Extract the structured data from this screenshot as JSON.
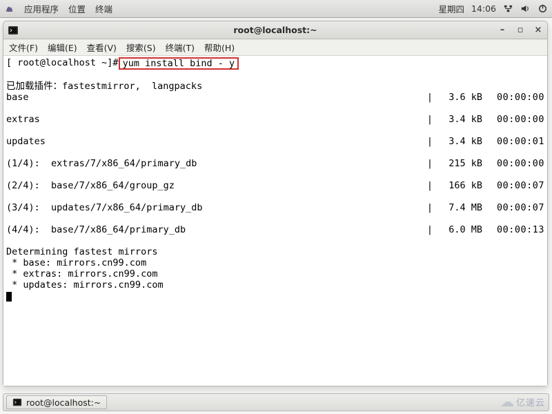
{
  "top_panel": {
    "menus": {
      "apps": "应用程序",
      "places": "位置",
      "terminal": "终端"
    },
    "clock_day": "星期四",
    "clock_time": "14:06"
  },
  "window": {
    "title": "root@localhost:~",
    "menus": {
      "file": "文件(F)",
      "edit": "编辑(E)",
      "view": "查看(V)",
      "search": "搜索(S)",
      "terminal": "终端(T)",
      "help": "帮助(H)"
    }
  },
  "terminal": {
    "prompt": "[ root@localhost ~]#",
    "command": "yum install bind - y",
    "line_plugins": "已加载插件：fastestmirror,  langpacks",
    "repos": [
      {
        "name": "base",
        "size": "3.6 kB",
        "time": "00:00:00"
      },
      {
        "name": "extras",
        "size": "3.4 kB",
        "time": "00:00:00"
      },
      {
        "name": "updates",
        "size": "3.4 kB",
        "time": "00:00:01"
      }
    ],
    "downloads": [
      {
        "name": "(1/4):  extras/7/x86_64/primary_db",
        "size": "215 kB",
        "time": "00:00:00"
      },
      {
        "name": "(2/4):  base/7/x86_64/group_gz",
        "size": "166 kB",
        "time": "00:00:07"
      },
      {
        "name": "(3/4):  updates/7/x86_64/primary_db",
        "size": "7.4 MB",
        "time": "00:00:07"
      },
      {
        "name": "(4/4):  base/7/x86_64/primary_db",
        "size": "6.0 MB",
        "time": "00:00:13"
      }
    ],
    "mirrors_header": "Determining fastest mirrors",
    "mirrors": [
      " * base: mirrors.cn99.com",
      " * extras: mirrors.cn99.com",
      " * updates: mirrors.cn99.com"
    ]
  },
  "taskbar": {
    "active_title": "root@localhost:~"
  },
  "watermark": "亿速云"
}
